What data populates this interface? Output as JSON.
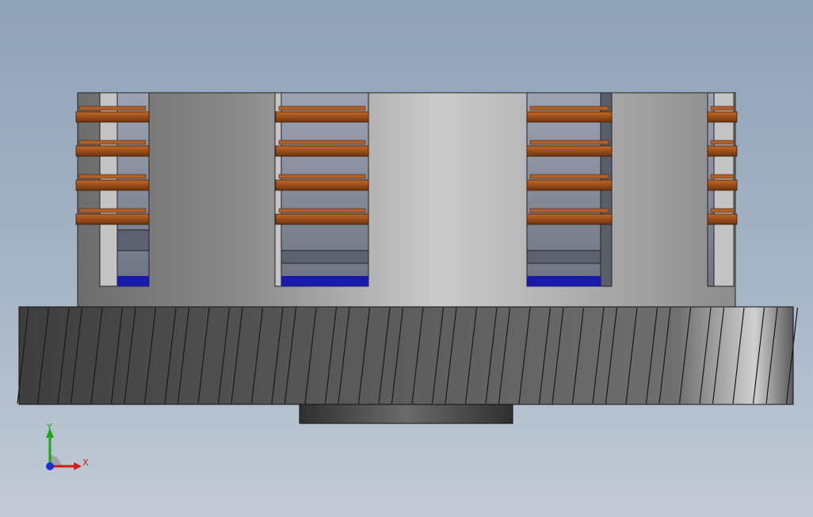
{
  "viewport": {
    "background_top": "#8fa3b8",
    "background_bottom": "#c2cbd6"
  },
  "model": {
    "colors": {
      "copper": "#a9561f",
      "copper_dark": "#6d3510",
      "blue_base": "#1a1aa8",
      "body_light": "#c9c9c9",
      "body_dark": "#6d6d6d",
      "gear": "#5a5a5a"
    },
    "window_count": 4,
    "copper_rows_per_window": 4
  },
  "triad": {
    "x_label": "X",
    "y_label": "Y",
    "x_color": "#d11a1a",
    "y_color": "#1aa81a",
    "z_color": "#1a2fd1"
  }
}
